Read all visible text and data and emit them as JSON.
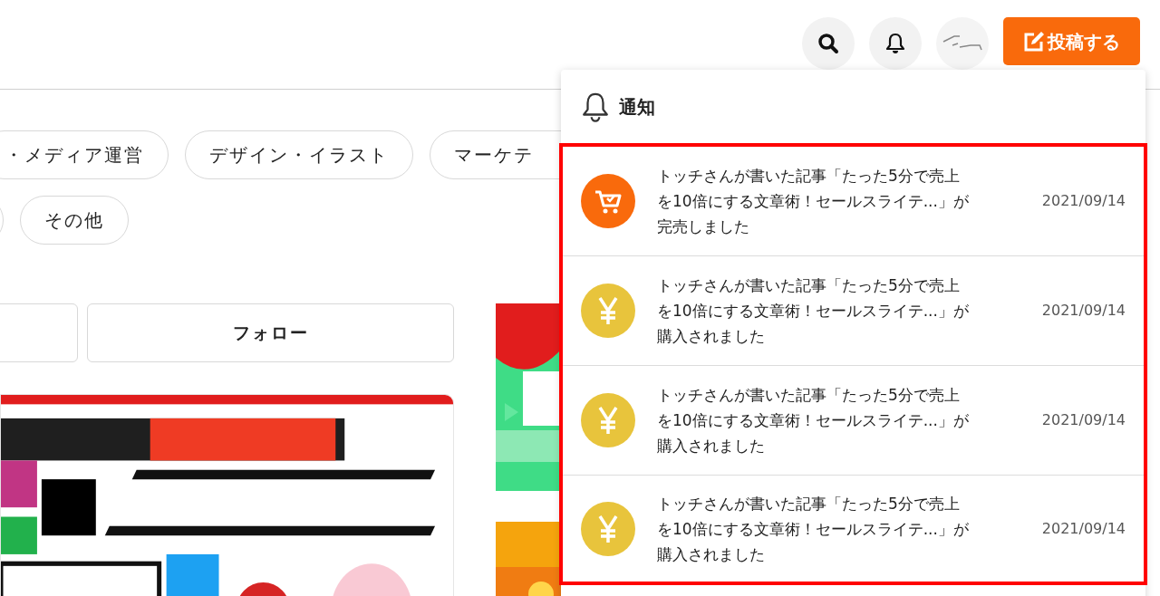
{
  "header": {
    "post_button": "投稿する"
  },
  "categories": [
    {
      "label": "・メディア運営"
    },
    {
      "label": "デザイン・イラスト"
    },
    {
      "label": "マーケテ"
    }
  ],
  "categories_row2": [
    {
      "label": "その他"
    }
  ],
  "follow_button": "フォロー",
  "notifications": {
    "title": "通知",
    "items": [
      {
        "kind": "cart",
        "message_lines": [
          "トッチさんが書いた記事「たった5分で売上",
          "を10倍にする文章術！セールスライテ...」が",
          "完売しました"
        ],
        "date": "2021/09/14"
      },
      {
        "kind": "yen",
        "message_lines": [
          "トッチさんが書いた記事「たった5分で売上",
          "を10倍にする文章術！セールスライテ...」が",
          "購入されました"
        ],
        "date": "2021/09/14"
      },
      {
        "kind": "yen",
        "message_lines": [
          "トッチさんが書いた記事「たった5分で売上",
          "を10倍にする文章術！セールスライテ...」が",
          "購入されました"
        ],
        "date": "2021/09/14"
      },
      {
        "kind": "yen",
        "message_lines": [
          "トッチさんが書いた記事「たった5分で売上",
          "を10倍にする文章術！セールスライテ...」が",
          "購入されました"
        ],
        "date": "2021/09/14"
      }
    ]
  }
}
